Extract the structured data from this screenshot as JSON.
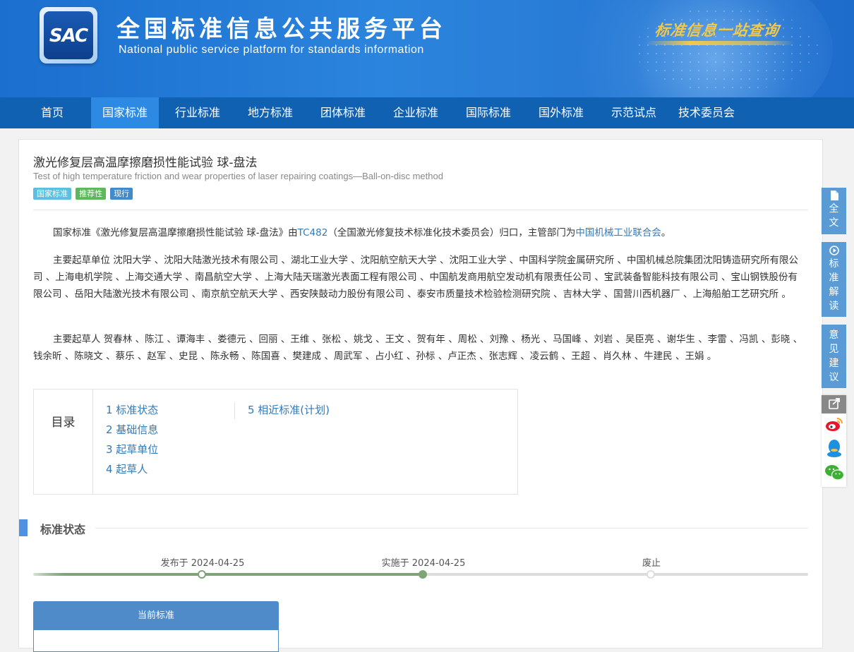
{
  "header": {
    "logo_text": "SAC",
    "title": "全国标准信息公共服务平台",
    "subtitle": "National public service platform  for standards information",
    "slogan": "标准信息一站查询"
  },
  "nav": {
    "items": [
      "首页",
      "国家标准",
      "行业标准",
      "地方标准",
      "团体标准",
      "企业标准",
      "国际标准",
      "国外标准",
      "示范试点",
      "技术委员会"
    ],
    "active": "国家标准"
  },
  "standard": {
    "title_cn": "激光修复层高温摩擦磨损性能试验 球-盘法",
    "title_en": "Test of high temperature friction and wear properties of laser repairing coatings—Ball-on-disc method",
    "tags": [
      "国家标准",
      "推荐性",
      "现行"
    ],
    "intro_prefix": "国家标准《激光修复层高温摩擦磨损性能试验 球-盘法》由",
    "tc_code": "TC482",
    "tc_name": "（全国激光修复技术标准化技术委员会）归口，主管部门为",
    "dept": "中国机械工业联合会",
    "intro_suffix": "。",
    "drafting_units": "主要起草单位 沈阳大学 、沈阳大陆激光技术有限公司 、湖北工业大学 、沈阳航空航天大学 、沈阳工业大学 、中国科学院金属研究所 、中国机械总院集团沈阳铸造研究所有限公司 、上海电机学院 、上海交通大学 、南昌航空大学 、上海大陆天瑞激光表面工程有限公司 、中国航发商用航空发动机有限责任公司 、宝武装备智能科技有限公司 、宝山钢铁股份有限公司 、岳阳大陆激光技术有限公司 、南京航空航天大学 、西安陕鼓动力股份有限公司 、泰安市质量技术检验检测研究院 、吉林大学 、国营川西机器厂 、上海船舶工艺研究所 。",
    "drafters": "主要起草人 贺春林 、陈江 、谭海丰 、娄德元 、回丽 、王维 、张松 、姚戈 、王文 、贺有年 、周松 、刘豫 、杨光 、马国峰 、刘岩 、吴臣亮 、谢华生 、李雷 、冯凯 、彭晓 、钱余昕 、陈晓文 、蔡乐 、赵军 、史昆 、陈永畅 、陈国喜 、樊建成 、周武军 、占小红 、孙标 、卢正杰 、张志辉 、凌云鹤 、王超 、肖久林 、牛建民 、王娟 。"
  },
  "toc": {
    "label": "目录",
    "items": [
      "1  标准状态",
      "2  基础信息",
      "3  起草单位",
      "4  起草人",
      "5  相近标准(计划)"
    ]
  },
  "status": {
    "section_title": "标准状态",
    "published_label": "发布于 2024-04-25",
    "implemented_label": "实施于 2024-04-25",
    "abolished_label": "废止",
    "current_label": "当前标准"
  },
  "sidebar": {
    "full_text": "全文",
    "interpretation": "标准解读",
    "feedback": "意见建议"
  },
  "colors": {
    "nav_bg": "#1161b3",
    "nav_active": "#2d8ae4",
    "link": "#337ab7",
    "timeline": "#7fa478"
  }
}
